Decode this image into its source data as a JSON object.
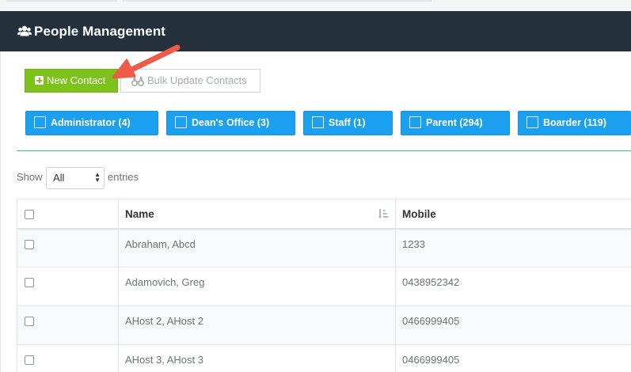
{
  "header": {
    "title": "People Management",
    "icon": "users-icon",
    "background": "#24313d"
  },
  "toolbar": {
    "new_contact_label": "New Contact",
    "bulk_update_label": "Bulk Update Contacts",
    "accent_green": "#7ec31c"
  },
  "roles": [
    {
      "label": "Administrator (4)"
    },
    {
      "label": "Dean's Office (3)"
    },
    {
      "label": "Staff (1)"
    },
    {
      "label": "Parent (294)"
    },
    {
      "label": "Boarder (119)"
    }
  ],
  "role_color": "#1aa0ee",
  "table_controls": {
    "show_label": "Show",
    "entries_value": "All",
    "entries_label": "entries"
  },
  "table": {
    "columns": [
      "",
      "Name",
      "Mobile"
    ],
    "rows": [
      {
        "name": "Abraham, Abcd",
        "mobile": "1233"
      },
      {
        "name": "Adamovich, Greg",
        "mobile": "0438952342"
      },
      {
        "name": "AHost 2, AHost 2",
        "mobile": "0466999405"
      },
      {
        "name": "AHost 3, AHost 3",
        "mobile": "0466999405"
      }
    ]
  }
}
